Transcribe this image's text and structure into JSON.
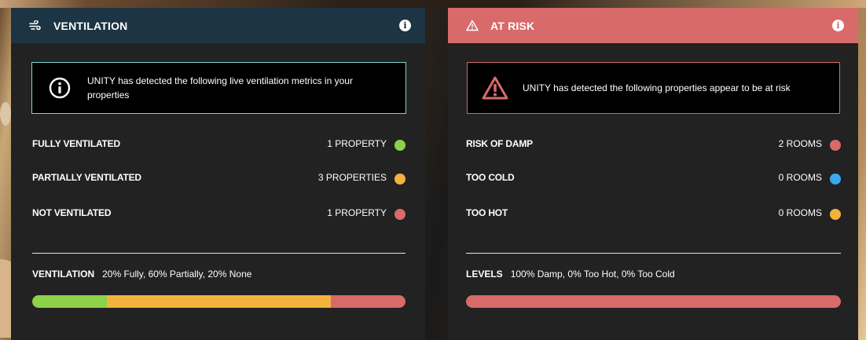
{
  "colors": {
    "green": "#8ed14a",
    "amber": "#f2b33d",
    "red": "#d86a6a",
    "blue": "#3aa9ee",
    "teal_border": "#7dd6d6"
  },
  "ventilation": {
    "title": "VENTILATION",
    "header_icon": "ventilation-wind-icon",
    "info_icon": "info-icon",
    "alert_icon": "info-circle-icon",
    "alert_text": "UNITY has detected the following live ventilation metrics in your properties",
    "metrics": [
      {
        "label": "FULLY VENTILATED",
        "value": "1 PROPERTY",
        "color": "#8ed14a"
      },
      {
        "label": "PARTIALLY VENTILATED",
        "value": "3 PROPERTIES",
        "color": "#f2b33d"
      },
      {
        "label": "NOT VENTILATED",
        "value": "1 PROPERTY",
        "color": "#d86a6a"
      }
    ],
    "summary_label": "VENTILATION",
    "summary_text": "20% Fully, 60% Partially, 20% None",
    "bar": [
      {
        "name": "fully",
        "fraction": 0.2,
        "color": "#8ed14a"
      },
      {
        "name": "partially",
        "fraction": 0.6,
        "color": "#f2b33d"
      },
      {
        "name": "none",
        "fraction": 0.2,
        "color": "#d86a6a"
      }
    ]
  },
  "risk": {
    "title": "AT RISK",
    "header_icon": "warning-triangle-icon",
    "info_icon": "info-icon",
    "alert_icon": "warning-triangle-icon",
    "alert_text": "UNITY has detected the following properties appear to be at risk",
    "metrics": [
      {
        "label": "RISK OF DAMP",
        "value": "2 ROOMS",
        "color": "#d86a6a"
      },
      {
        "label": "TOO COLD",
        "value": "0 ROOMS",
        "color": "#3aa9ee"
      },
      {
        "label": "TOO HOT",
        "value": "0 ROOMS",
        "color": "#f2b33d"
      }
    ],
    "summary_label": "LEVELS",
    "summary_text": "100% Damp, 0% Too Hot, 0% Too Cold",
    "bar": [
      {
        "name": "damp",
        "fraction": 1.0,
        "color": "#d86a6a"
      },
      {
        "name": "too-hot",
        "fraction": 0.0,
        "color": "#f2b33d"
      },
      {
        "name": "too-cold",
        "fraction": 0.0,
        "color": "#3aa9ee"
      }
    ]
  }
}
